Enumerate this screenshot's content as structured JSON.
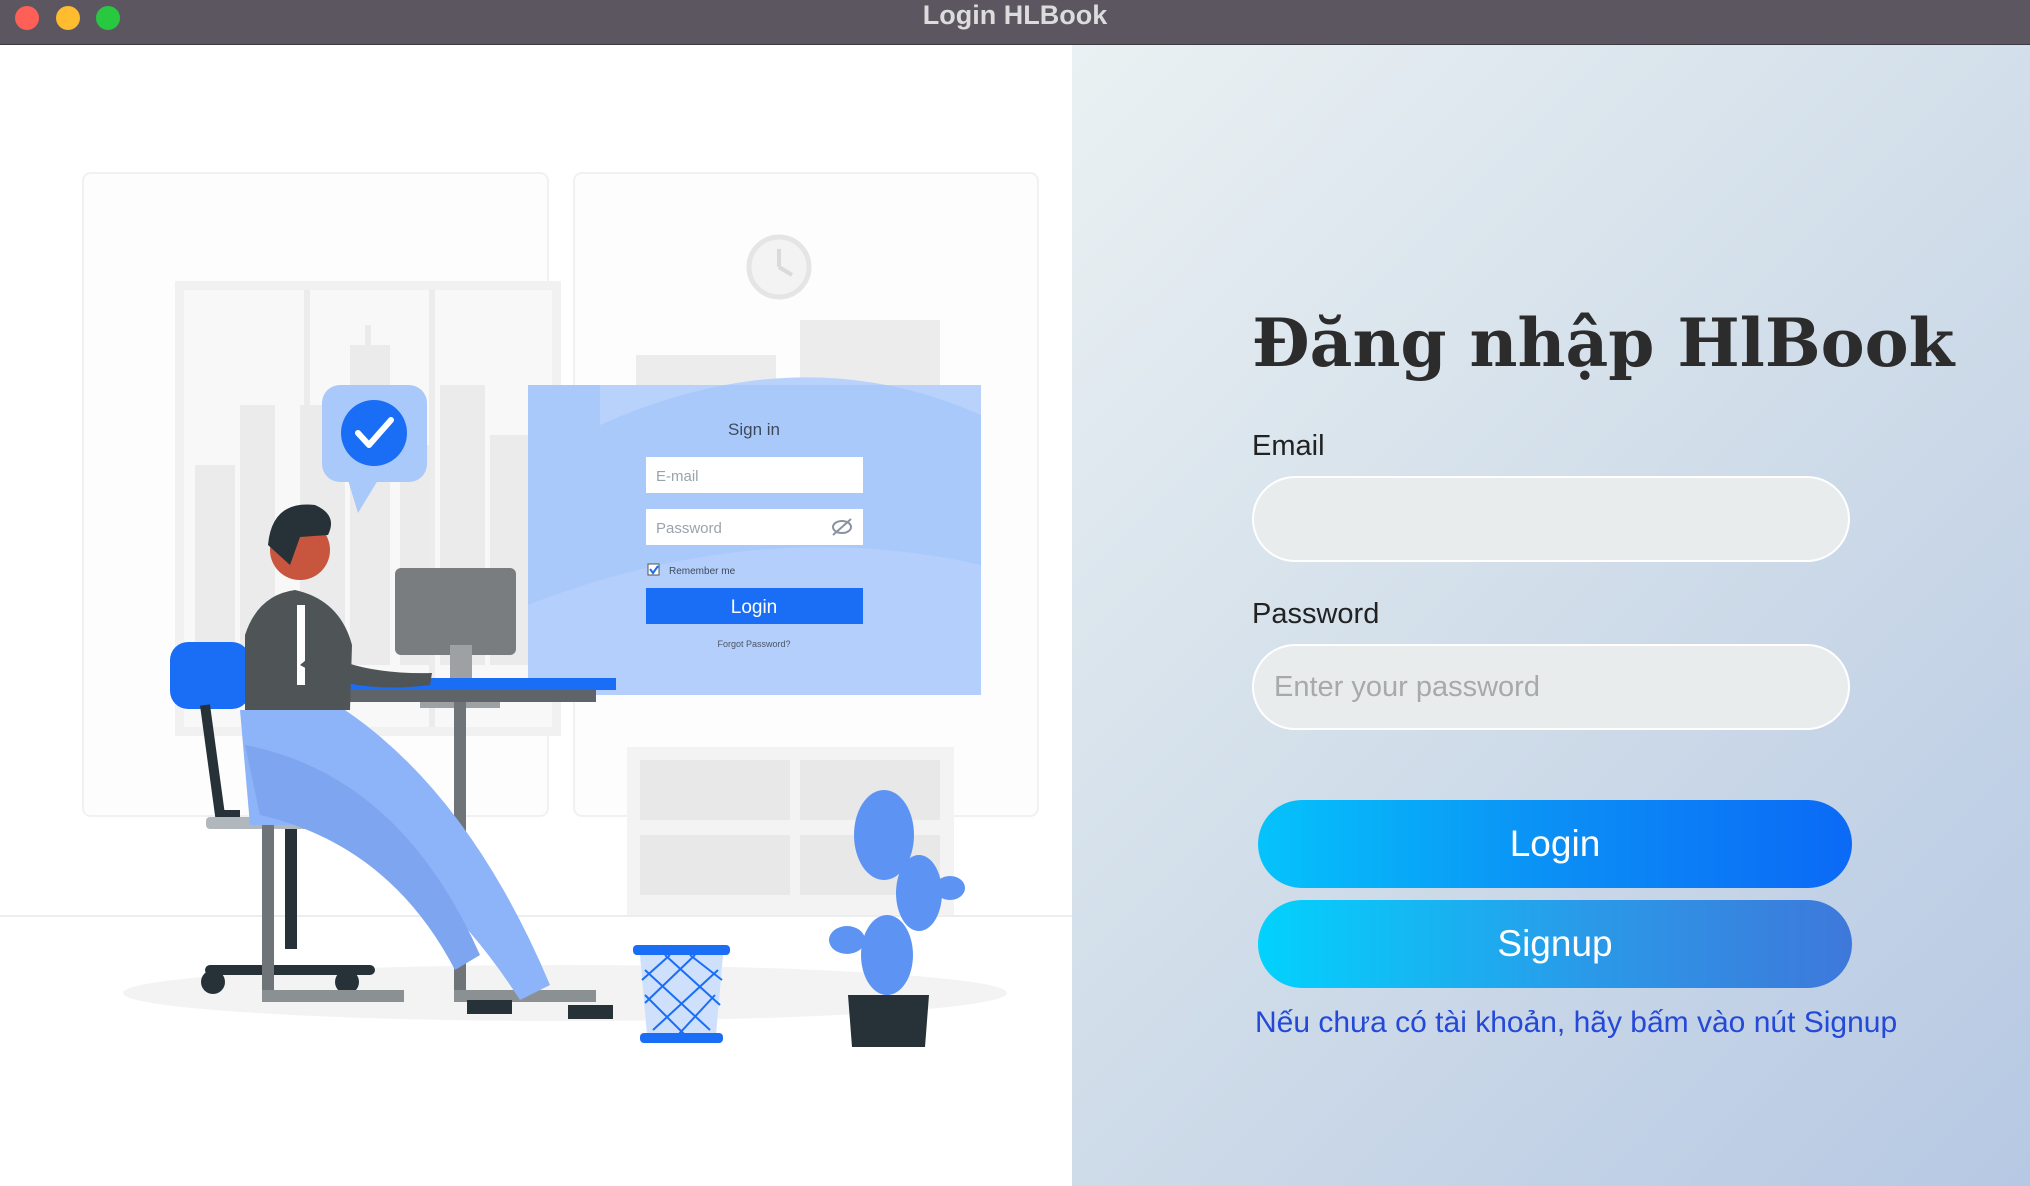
{
  "window": {
    "title": "Login HLBook"
  },
  "illustration": {
    "signin_title": "Sign in",
    "email_placeholder": "E-mail",
    "password_placeholder": "Password",
    "remember_label": "Remember me",
    "login_label": "Login",
    "forgot_label": "Forgot Password?"
  },
  "form": {
    "heading": "Đăng nhập HlBook",
    "email_label": "Email",
    "email_value": "",
    "email_placeholder": "",
    "password_label": "Password",
    "password_placeholder": "Enter your password",
    "login_label": "Login",
    "signup_label": "Signup",
    "hint": "Nếu chưa có tài khoản, hãy bấm vào nút Signup"
  },
  "colors": {
    "titlebar": "#5b5660",
    "accent_blue": "#0b69f6",
    "hint_text": "#2448d8",
    "illustration_blue": "#1a6ef5"
  }
}
